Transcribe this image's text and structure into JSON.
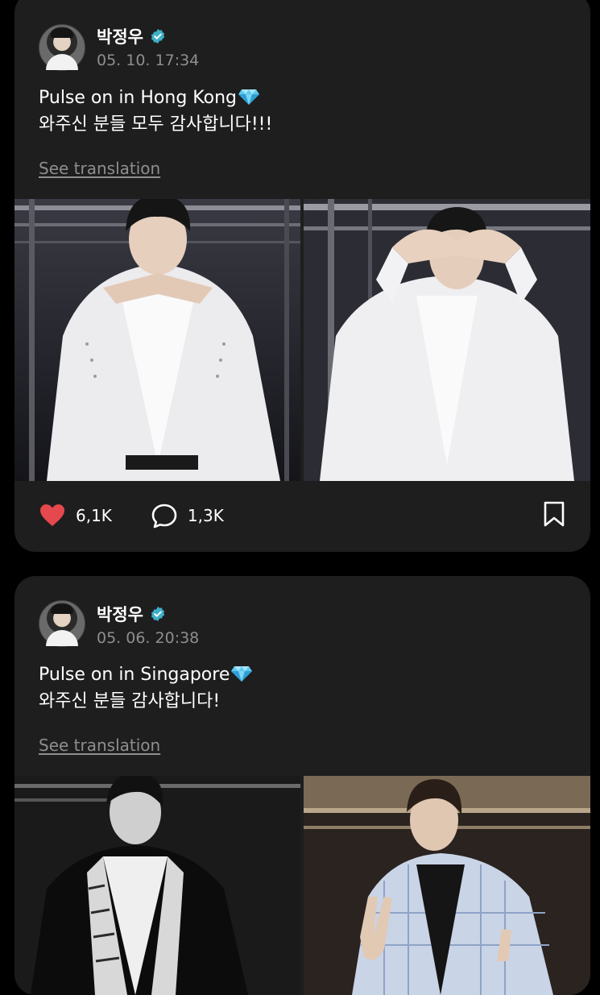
{
  "posts": [
    {
      "username": "박정우",
      "verified_icon": "verified-badge-icon",
      "timestamp": "05. 10. 17:34",
      "caption_line1": "Pulse on in Hong Kong",
      "caption_line2": "와주신 분들 모두 감사합니다!!!",
      "emoji": "gem-icon",
      "see_translation": "See translation",
      "likes": "6,1K",
      "comments": "1,3K",
      "liked": true
    },
    {
      "username": "박정우",
      "verified_icon": "verified-badge-icon",
      "timestamp": "05. 06. 20:38",
      "caption_line1": "Pulse on in Singapore",
      "caption_line2": "와주신 분들 감사합니다!",
      "emoji": "gem-icon",
      "see_translation": "See translation"
    }
  ],
  "colors": {
    "background": "#000000",
    "card": "#1e1e1e",
    "like": "#e5484d",
    "verified": "#3fb0c8",
    "muted_text": "#8e8e8e"
  }
}
